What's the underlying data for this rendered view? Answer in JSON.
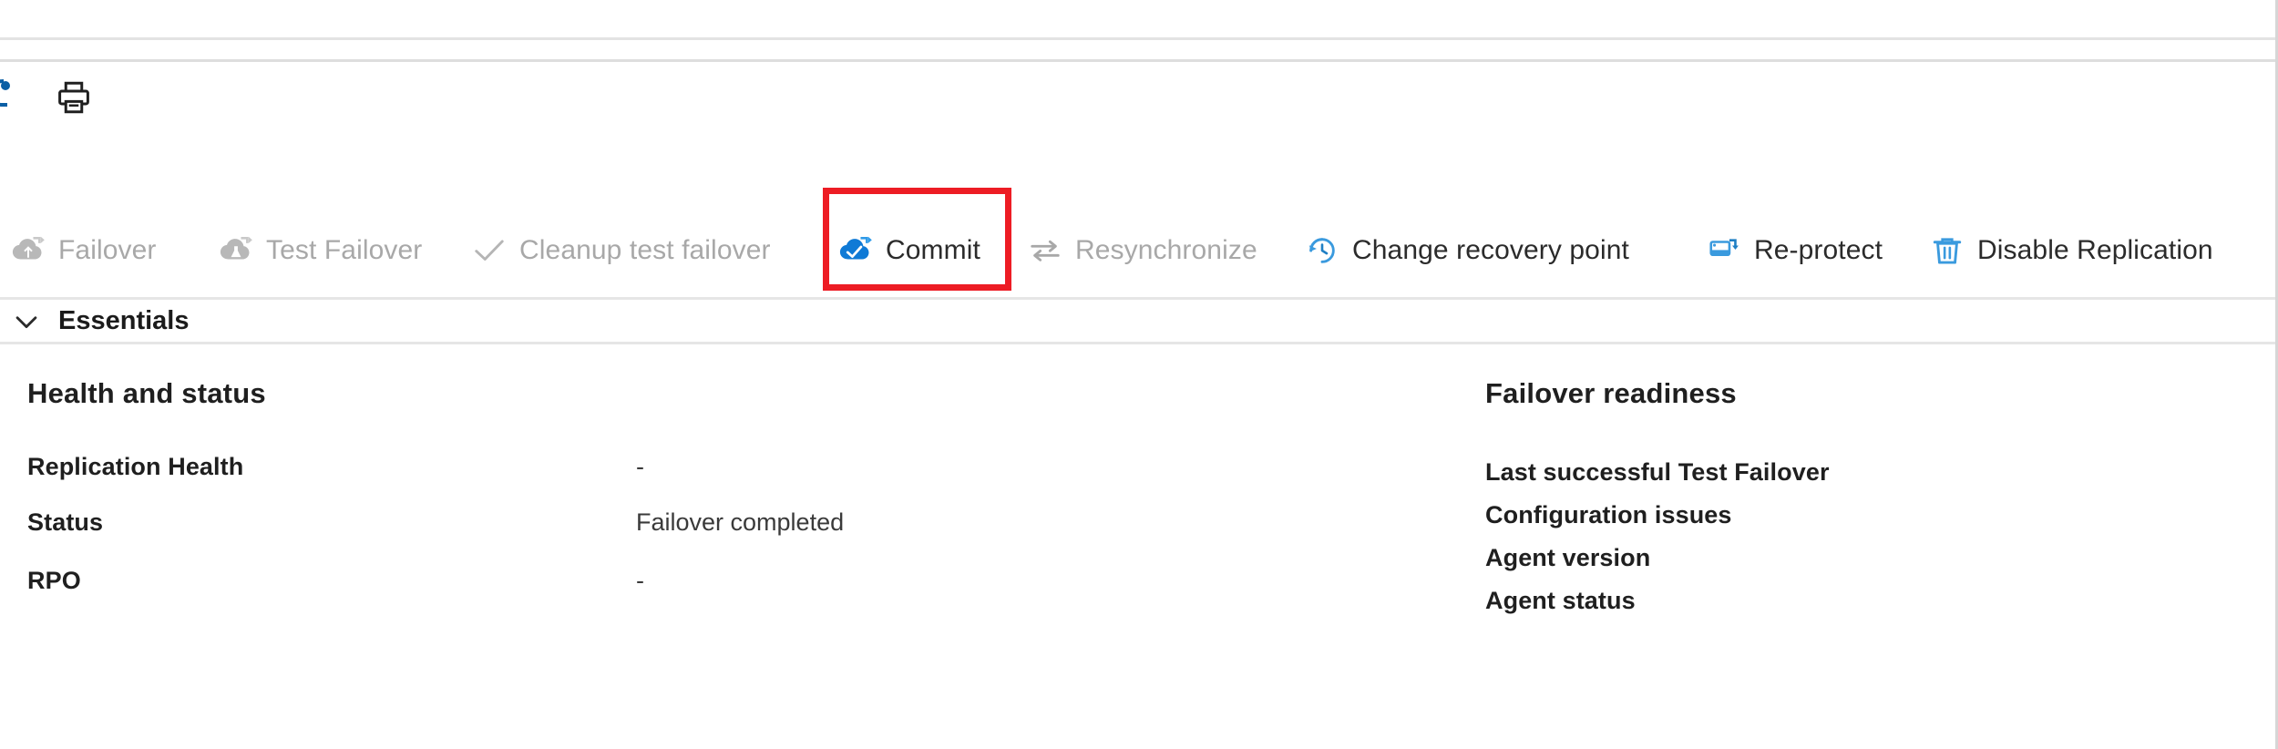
{
  "window": {
    "print_icon": "printer-icon",
    "clipped_left_icon": "partial-icon"
  },
  "toolbar": {
    "items": [
      {
        "label": "Failover",
        "icon": "failover-cloud-icon",
        "enabled": false,
        "highlighted": false
      },
      {
        "label": "Test Failover",
        "icon": "test-failover-cloud-icon",
        "enabled": false,
        "highlighted": false
      },
      {
        "label": "Cleanup test failover",
        "icon": "checkmark-icon",
        "enabled": false,
        "highlighted": false
      },
      {
        "label": "Commit",
        "icon": "commit-cloud-check-icon",
        "enabled": true,
        "highlighted": true
      },
      {
        "label": "Resynchronize",
        "icon": "resynchronize-arrows-icon",
        "enabled": false,
        "highlighted": false
      },
      {
        "label": "Change recovery point",
        "icon": "history-clock-icon",
        "enabled": true,
        "highlighted": false
      },
      {
        "label": "Re-protect",
        "icon": "re-protect-icon",
        "enabled": true,
        "highlighted": false
      },
      {
        "label": "Disable Replication",
        "icon": "trash-icon",
        "enabled": true,
        "highlighted": false
      }
    ],
    "highlight_color": "#ed1c24"
  },
  "essentials": {
    "label": "Essentials",
    "chevron": "chevron-down-icon",
    "expanded": true
  },
  "health_and_status": {
    "title": "Health and status",
    "rows": [
      {
        "key": "Replication Health",
        "value": "-"
      },
      {
        "key": "Status",
        "value": "Failover completed"
      },
      {
        "key": "RPO",
        "value": "-"
      }
    ]
  },
  "failover_readiness": {
    "title": "Failover readiness",
    "rows": [
      {
        "key": "Last successful Test Failover",
        "value": ""
      },
      {
        "key": "Configuration issues",
        "value": ""
      },
      {
        "key": "Agent version",
        "value": ""
      },
      {
        "key": "Agent status",
        "value": ""
      }
    ]
  },
  "colors": {
    "accent_blue": "#0078d4",
    "disabled_grey": "#a8a8a8",
    "text": "#1f1f1f",
    "divider": "#e6e6e6"
  }
}
